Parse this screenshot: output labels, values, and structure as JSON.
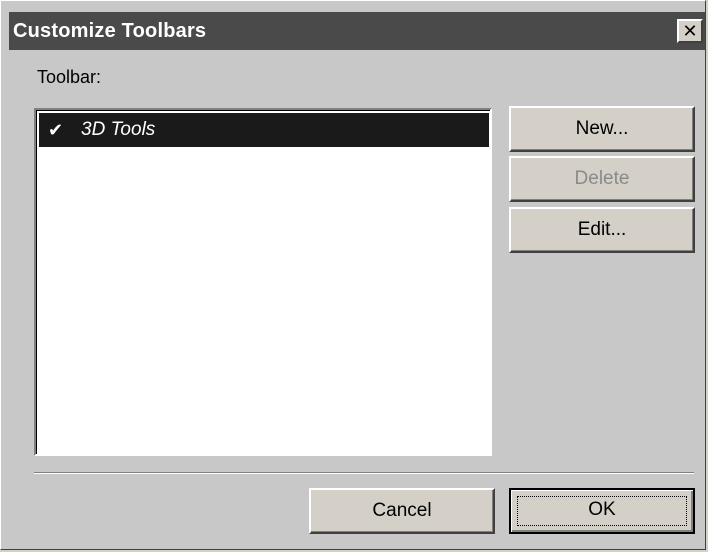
{
  "window": {
    "title": "Customize Toolbars",
    "close_glyph": "✕"
  },
  "toolbar_section": {
    "label": "Toolbar:",
    "items": [
      {
        "check_glyph": "✔",
        "label": "3D Tools",
        "checked": true,
        "selected": true
      }
    ]
  },
  "side_buttons": {
    "new_label": "New...",
    "delete_label": "Delete",
    "edit_label": "Edit..."
  },
  "footer_buttons": {
    "cancel_label": "Cancel",
    "ok_label": "OK"
  },
  "colors": {
    "title_bar": "#4a4a4a",
    "selection": "#1a1a1a",
    "dialog_face": "#c8c8c8",
    "disabled_text": "#8a8a8a"
  },
  "icons": {
    "close": "close-icon",
    "check": "checkmark-icon"
  }
}
